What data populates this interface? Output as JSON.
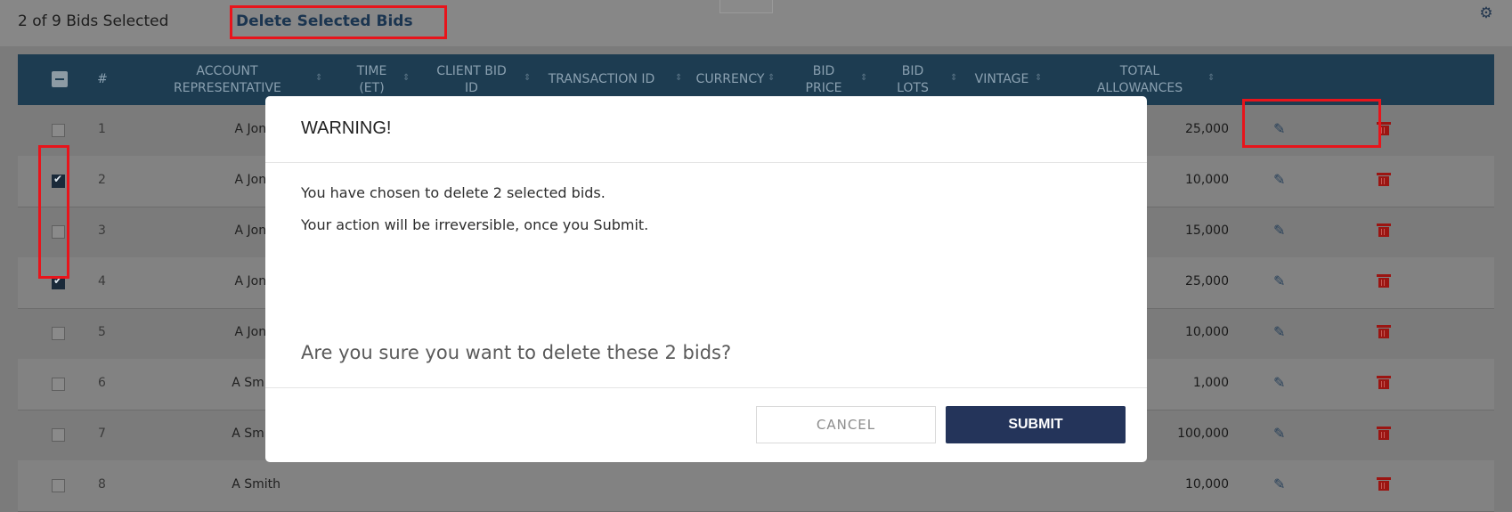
{
  "toolbar": {
    "selected_count": "2 of 9 Bids Selected",
    "delete_selected_label": "Delete Selected Bids"
  },
  "icons": {
    "settings": "gear-icon",
    "edit": "edit-icon",
    "delete": "trash-icon",
    "select_all": "minus-checkbox-icon"
  },
  "table": {
    "columns": [
      {
        "key": "select",
        "label": ""
      },
      {
        "key": "num",
        "label": "#"
      },
      {
        "key": "account_rep",
        "label": "ACCOUNT REPRESENTATIVE"
      },
      {
        "key": "time",
        "label": "TIME (ET)"
      },
      {
        "key": "client_bid_id",
        "label": "CLIENT BID ID"
      },
      {
        "key": "transaction_id",
        "label": "TRANSACTION ID"
      },
      {
        "key": "currency",
        "label": "CURRENCY"
      },
      {
        "key": "bid_price",
        "label": "BID PRICE"
      },
      {
        "key": "bid_lots",
        "label": "BID LOTS"
      },
      {
        "key": "vintage",
        "label": "VINTAGE"
      },
      {
        "key": "total_allowances",
        "label": "TOTAL ALLOWANCES"
      }
    ],
    "rows": [
      {
        "num": "1",
        "account_rep": "A Jones",
        "total_allowances": "25,000",
        "checked": false
      },
      {
        "num": "2",
        "account_rep": "A Jones",
        "total_allowances": "10,000",
        "checked": true
      },
      {
        "num": "3",
        "account_rep": "A Jones",
        "total_allowances": "15,000",
        "checked": false
      },
      {
        "num": "4",
        "account_rep": "A Jones",
        "total_allowances": "25,000",
        "checked": true
      },
      {
        "num": "5",
        "account_rep": "A Jones",
        "total_allowances": "10,000",
        "checked": false
      },
      {
        "num": "6",
        "account_rep": "A Smith",
        "total_allowances": "1,000",
        "checked": false
      },
      {
        "num": "7",
        "account_rep": "A Smith",
        "total_allowances": "100,000",
        "checked": false
      },
      {
        "num": "8",
        "account_rep": "A Smith",
        "total_allowances": "10,000",
        "checked": false
      }
    ]
  },
  "modal": {
    "title": "WARNING!",
    "message_line1": "You have chosen to delete 2 selected bids.",
    "message_line2": "Your action will be irreversible, once you Submit.",
    "question": "Are you sure you want to delete these 2 bids?",
    "cancel_label": "CANCEL",
    "submit_label": "SUBMIT"
  },
  "colors": {
    "header_bg": "#1d3c51",
    "submit_bg": "#24345a",
    "highlight": "#e8141b",
    "trash": "#9b1512"
  }
}
